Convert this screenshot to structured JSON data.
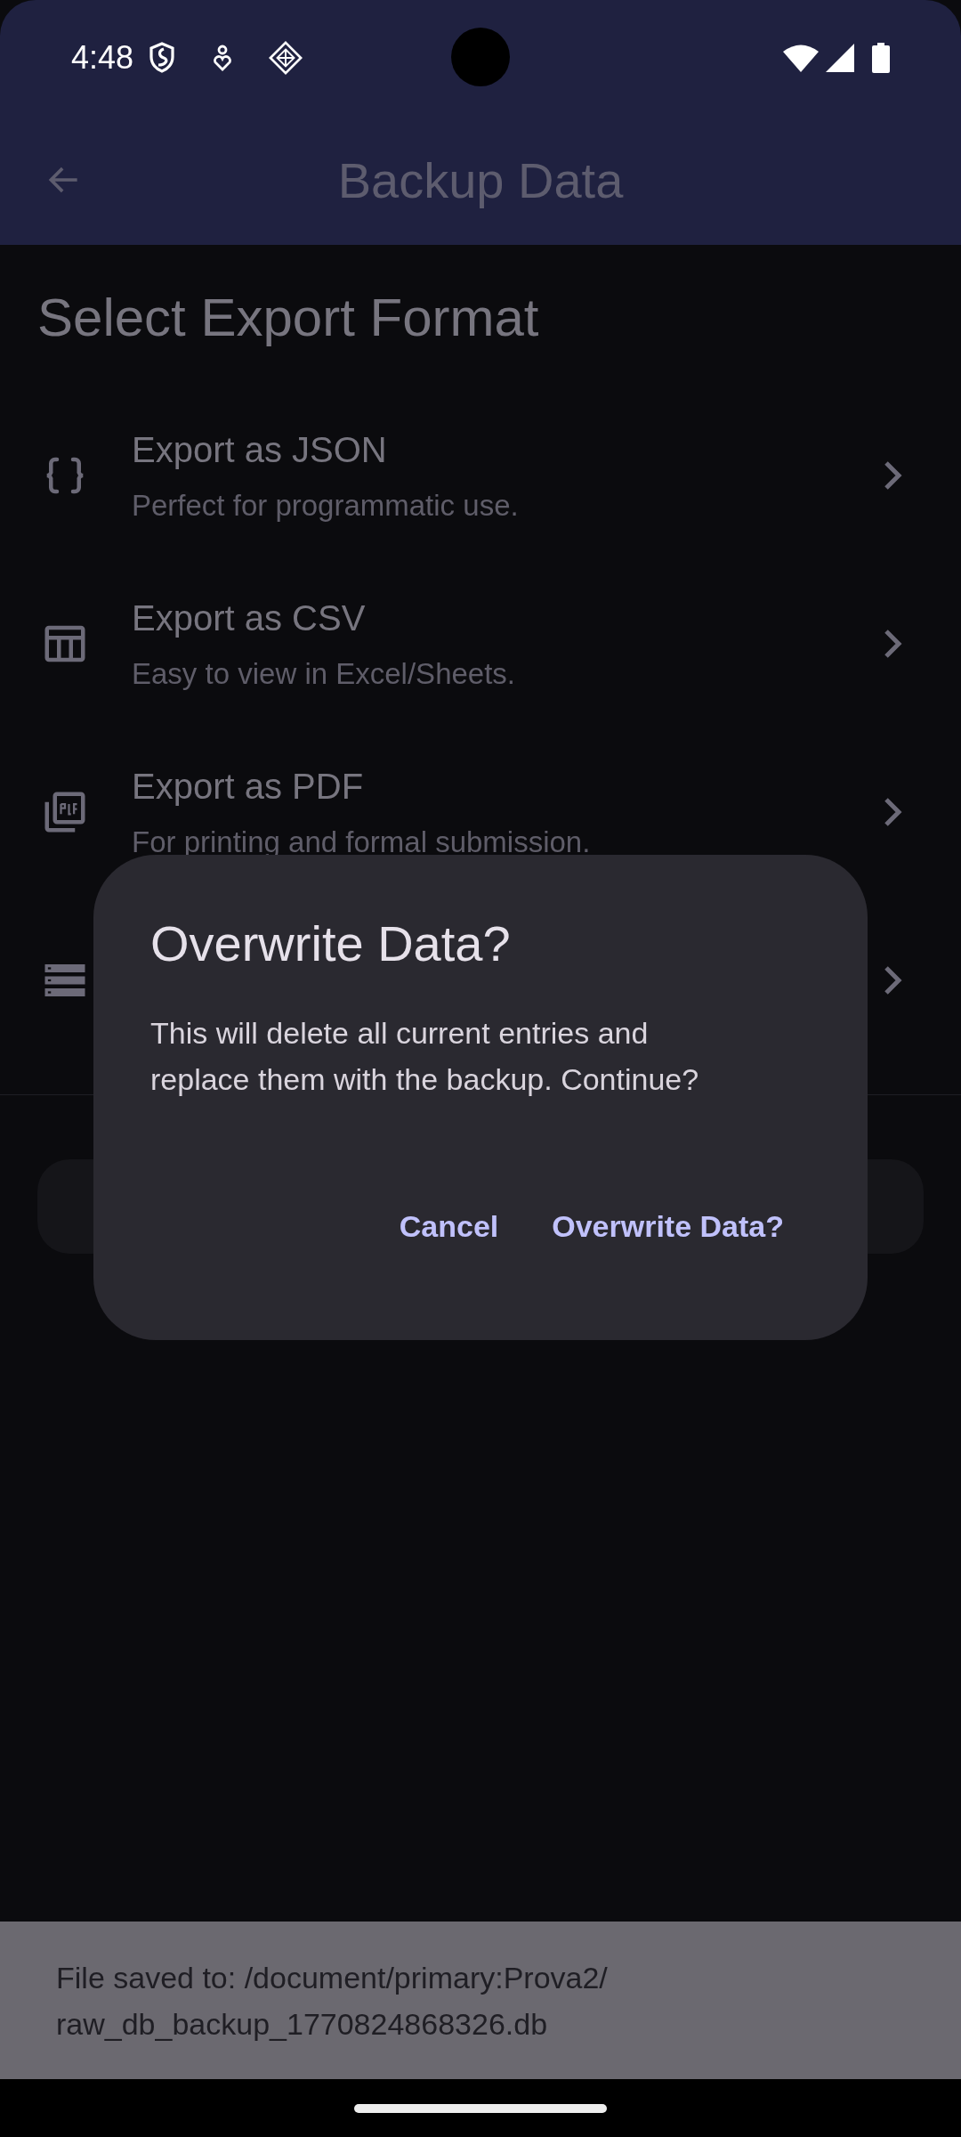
{
  "status_bar": {
    "time": "4:48"
  },
  "app_bar": {
    "title": "Backup Data"
  },
  "section_title": "Select Export Format",
  "formats": [
    {
      "kind": "json",
      "title": "Export as JSON",
      "subtitle": "Perfect for programmatic use."
    },
    {
      "kind": "csv",
      "title": "Export as CSV",
      "subtitle": "Easy to view in Excel/Sheets."
    },
    {
      "kind": "pdf",
      "title": "Export as PDF",
      "subtitle": "For printing and formal submission."
    },
    {
      "kind": "raw"
    }
  ],
  "dialog": {
    "title": "Overwrite Data?",
    "message": "This will delete all current entries and replace them with the backup. Continue?",
    "buttons": [
      "Cancel",
      "Overwrite Data?"
    ]
  },
  "snackbar": {
    "message": "File saved to: /document/primary:Prova2/ raw_db_backup_1770824868326.db"
  }
}
